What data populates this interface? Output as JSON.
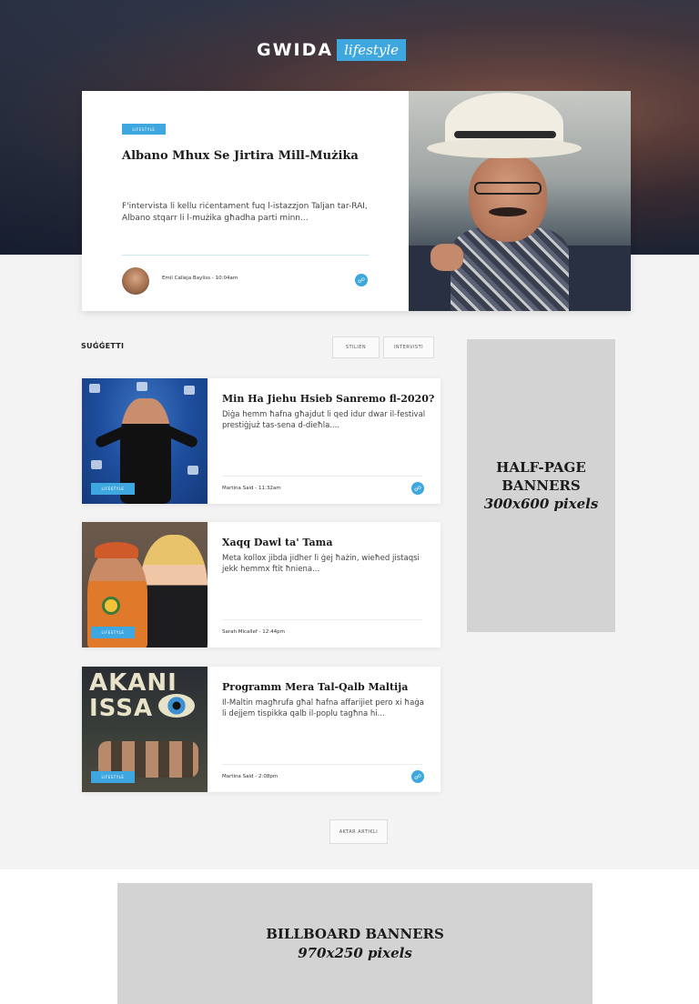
{
  "brand": {
    "name": "GWIDA",
    "sub": "lifestyle",
    "accent": "#3fa7e0"
  },
  "featured": {
    "tag": "LIFESTYLE",
    "headline": "Albano Mhux Se Jirtira Mill-Mużika",
    "excerpt": "F'intervista li kellu riċentament fuq l-istazzjon Taljan tar-RAI, Albano stqarr li l-mużika għadha parti minn...",
    "meta": "Emil Calleja Bayliss - 10:04am"
  },
  "section": {
    "title": "SUĠĠETTI",
    "filters": [
      "STILIEN",
      "INTERVISTI"
    ]
  },
  "articles": [
    {
      "tag": "LIFESTYLE",
      "title": "Min Ha Jiehu Hsieb Sanremo fl-2020?",
      "excerpt": "Diġa hemm ħafna għajdut li qed idur dwar il-festival prestiġjuż tas-sena d-dieħla....",
      "meta": "Martina Said - 11:32am"
    },
    {
      "tag": "LIFESTYLE",
      "title": "Xaqq Dawl ta' Tama",
      "excerpt": "Meta kollox jibda jidher li ġej ħażin, wieħed jistaqsi jekk hemmx ftit ħniena...",
      "meta": "Sarah Micallef - 12:44pm"
    },
    {
      "tag": "LIFESTYLE",
      "title": "Programm Mera Tal-Qalb Maltija",
      "excerpt": "Il-Maltin magħrufa għal ħafna affarijiet pero xi ħaġa li dejjem tispikka qalb il-poplu tagħna hi...",
      "meta": "Martina Said - 2:08pm"
    }
  ],
  "thumb3_text": "AKANI\nISSA",
  "more_label": "AKTAR ARTIKLI",
  "half_page_banner": {
    "line1": "HALF-PAGE",
    "line2": "BANNERS",
    "line3": "300x600 pixels"
  },
  "billboard_banner": {
    "line1": "BILLBOARD BANNERS",
    "line2": "970x250 pixels"
  }
}
